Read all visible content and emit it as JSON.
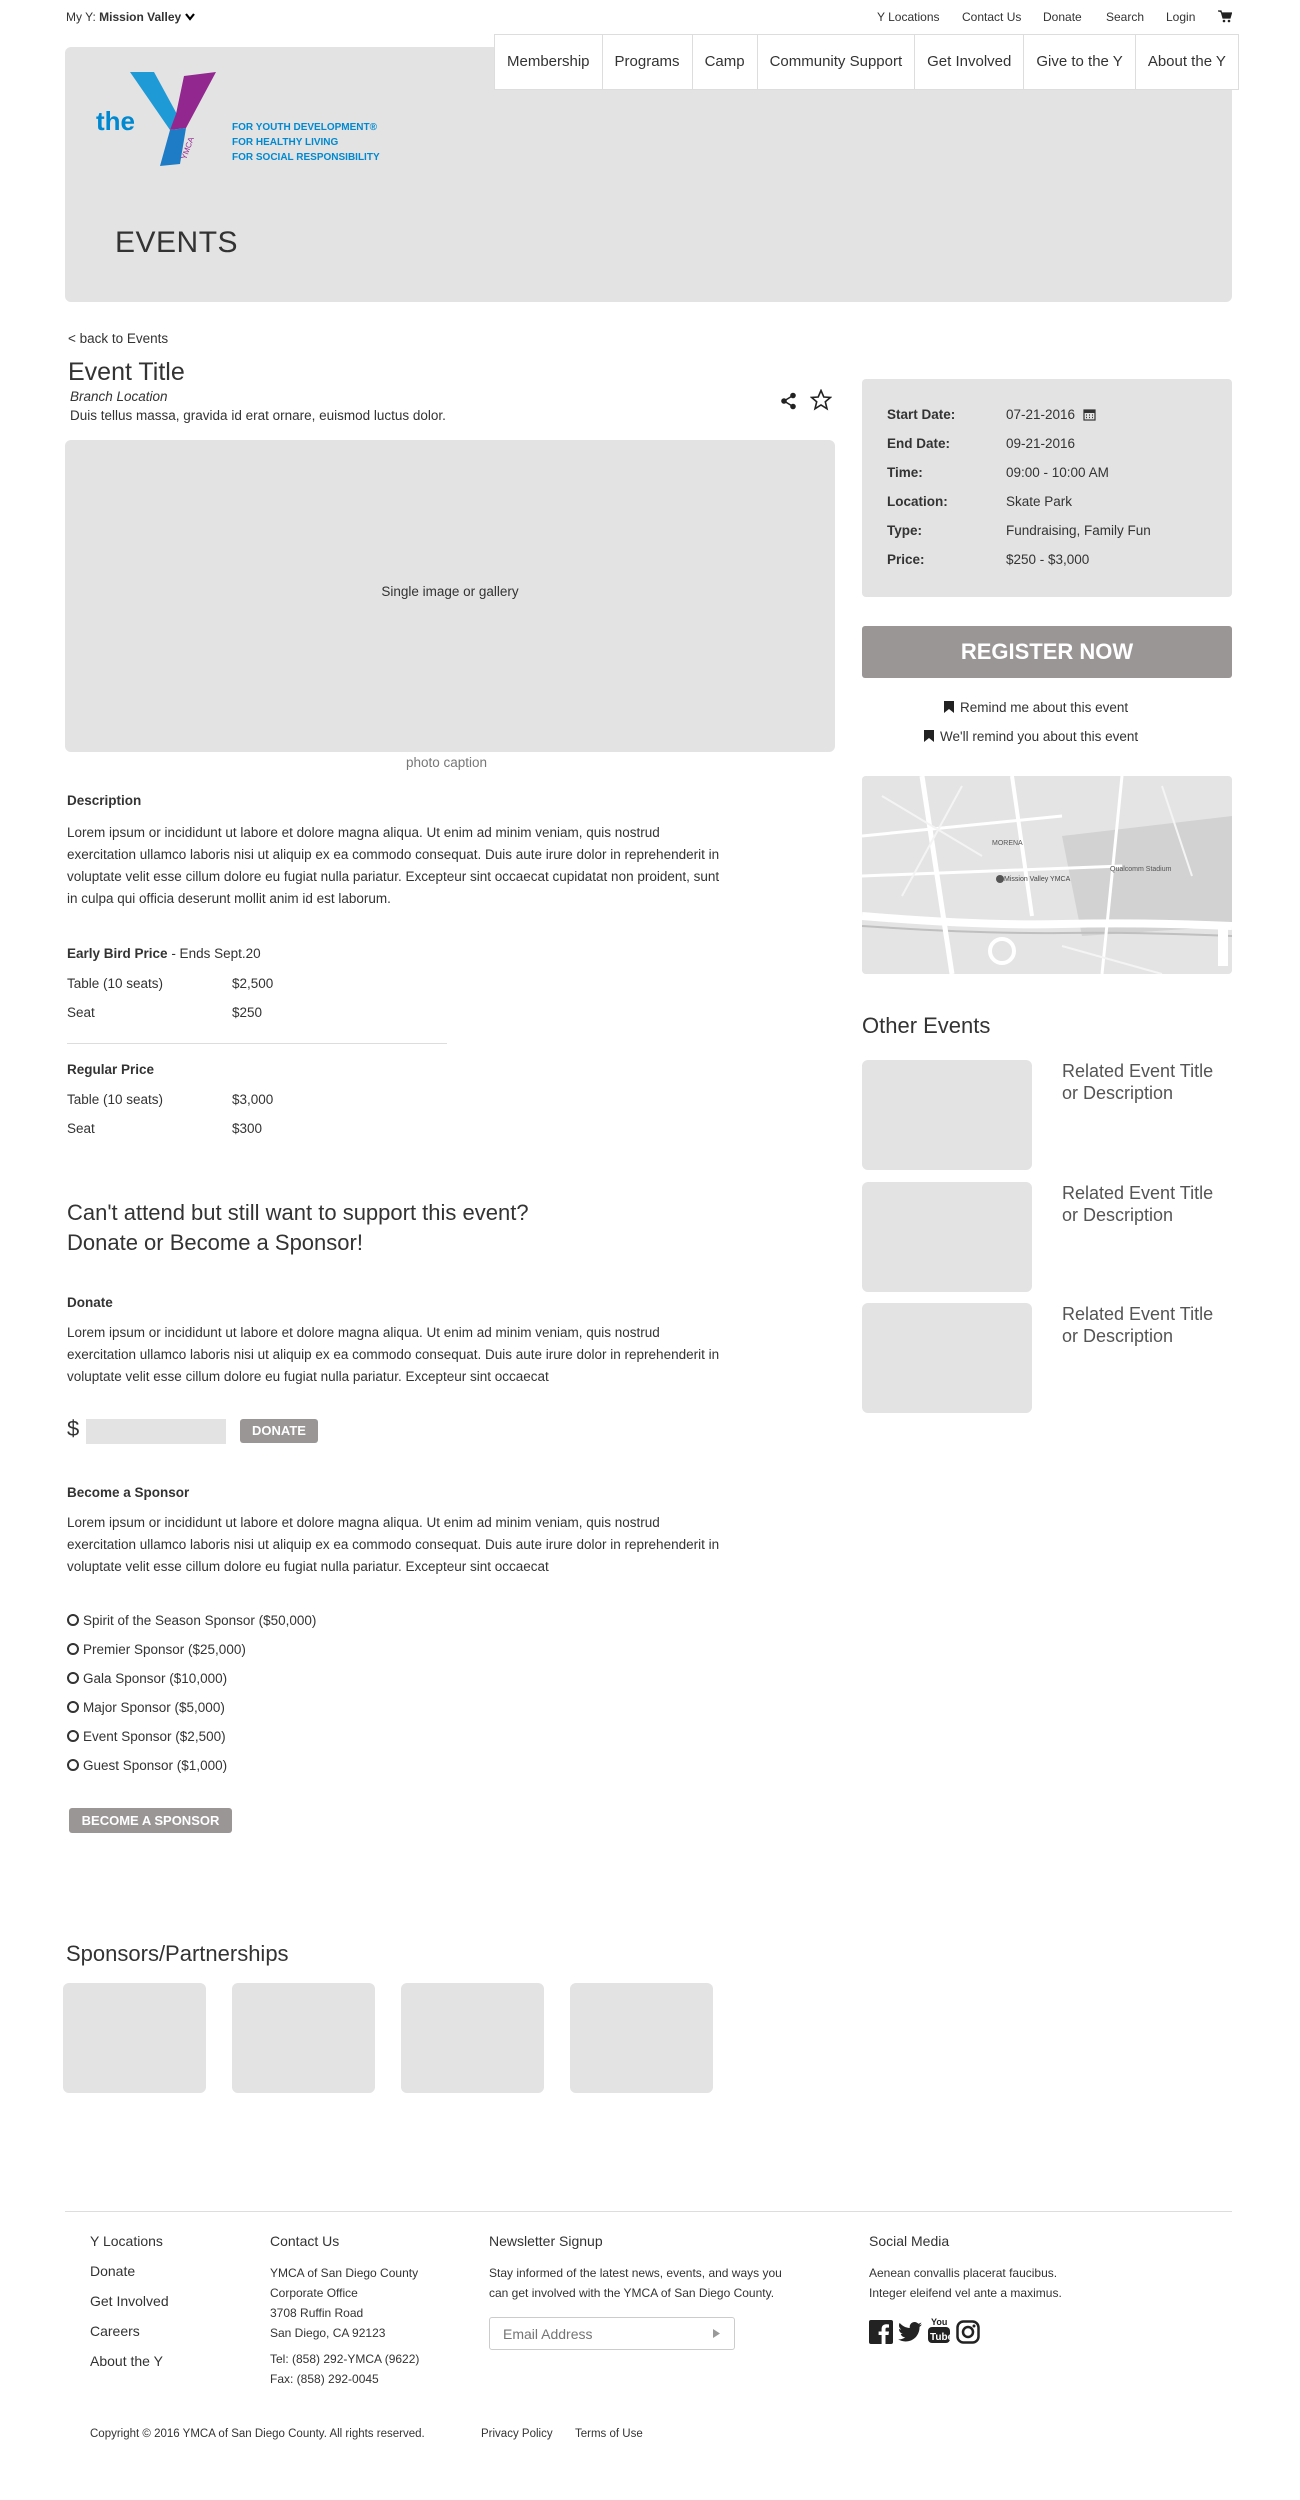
{
  "topbar": {
    "my_y_label": "My Y:",
    "my_y_value": "Mission Valley",
    "links": [
      "Y Locations",
      "Contact Us",
      "Donate",
      "Search",
      "Login"
    ]
  },
  "nav": [
    "Membership",
    "Programs",
    "Camp",
    "Community Support",
    "Get Involved",
    "Give to the Y",
    "About the Y"
  ],
  "logo": {
    "the": "the",
    "ymca": "YMCA",
    "tagline": [
      "FOR YOUTH DEVELOPMENT®",
      "FOR HEALTHY LIVING",
      "FOR SOCIAL RESPONSIBILITY"
    ]
  },
  "hero": {
    "title": "EVENTS"
  },
  "back_link": "< back to Events",
  "event": {
    "title": "Event Title",
    "branch": "Branch Location",
    "summary": "Duis tellus massa, gravida id erat ornare, euismod luctus dolor.",
    "gallery_label": "Single image or gallery",
    "caption": "photo caption"
  },
  "description": {
    "heading": "Description",
    "text": "Lorem ipsum or incididunt ut labore et dolore magna aliqua. Ut enim ad minim veniam, quis nostrud exercitation ullamco laboris nisi ut aliquip ex ea commodo consequat. Duis aute irure dolor in reprehenderit in voluptate velit esse cillum dolore eu fugiat nulla pariatur. Excepteur sint occaecat cupidatat non proident, sunt in culpa qui officia deserunt mollit anim id est laborum."
  },
  "early_bird": {
    "heading": "Early Bird Price",
    "suffix": " - Ends Sept.20",
    "rows": [
      {
        "item": "Table (10 seats)",
        "price": "$2,500"
      },
      {
        "item": "Seat",
        "price": "$250"
      }
    ]
  },
  "regular": {
    "heading": "Regular Price",
    "rows": [
      {
        "item": "Table (10 seats)",
        "price": "$3,000"
      },
      {
        "item": "Seat",
        "price": "$300"
      }
    ]
  },
  "support": {
    "line1": "Can't attend but still want to support this event?",
    "line2": "Donate or Become a Sponsor!"
  },
  "donate": {
    "heading": "Donate",
    "text": "Lorem ipsum or incididunt ut labore et dolore magna aliqua. Ut enim ad minim veniam, quis nostrud exercitation ullamco laboris nisi ut aliquip ex ea commodo consequat. Duis aute irure dolor in reprehenderit in voluptate velit esse cillum dolore eu fugiat nulla pariatur. Excepteur sint occaecat",
    "currency": "$",
    "amount": "",
    "button": "DONATE"
  },
  "sponsor": {
    "heading": "Become a Sponsor",
    "text": "Lorem ipsum or incididunt ut labore et dolore magna aliqua. Ut enim ad minim veniam, quis nostrud exercitation ullamco laboris nisi ut aliquip ex ea commodo consequat. Duis aute irure dolor in reprehenderit in voluptate velit esse cillum dolore eu fugiat nulla pariatur. Excepteur sint occaecat",
    "options": [
      "Spirit of the Season Sponsor ($50,000)",
      "Premier Sponsor ($25,000)",
      "Gala Sponsor ($10,000)",
      "Major Sponsor ($5,000)",
      "Event Sponsor ($2,500)",
      "Guest Sponsor ($1,000)"
    ],
    "button": "BECOME A SPONSOR"
  },
  "details": {
    "start_label": "Start Date:",
    "start": "07-21-2016",
    "end_label": "End Date:",
    "end": "09-21-2016",
    "time_label": "Time:",
    "time": "09:00 - 10:00 AM",
    "location_label": "Location:",
    "location": "Skate Park",
    "type_label": "Type:",
    "type": "Fundraising, Family Fun",
    "price_label": "Price:",
    "price": "$250 - $3,000"
  },
  "register": {
    "button": "REGISTER NOW",
    "remind_link": "Remind me about this event",
    "remind_confirm": "We'll remind you about this event"
  },
  "map": {
    "labels": [
      "Mission Valley YMCA",
      "MORENA",
      "Qualcomm Stadium"
    ]
  },
  "other_events": {
    "heading": "Other Events",
    "items": [
      {
        "line1": "Related Event Title",
        "line2": "or Description"
      },
      {
        "line1": "Related Event Title",
        "line2": "or Description"
      },
      {
        "line1": "Related Event Title",
        "line2": "or Description"
      }
    ]
  },
  "sponsors": {
    "heading": "Sponsors/Partnerships"
  },
  "footer": {
    "links": [
      "Y Locations",
      "Donate",
      "Get Involved",
      "Careers",
      "About the Y"
    ],
    "contact_heading": "Contact Us",
    "contact_lines": [
      "YMCA of San Diego County",
      "Corporate Office",
      "3708 Ruffin Road",
      "San Diego, CA 92123"
    ],
    "tel": "Tel: (858) 292-YMCA (9622)",
    "fax": "Fax: (858) 292-0045",
    "newsletter_heading": "Newsletter Signup",
    "newsletter_text_1": "Stay informed of the latest news, events, and ways you",
    "newsletter_text_2": "can get involved with the YMCA of San Diego County.",
    "email_placeholder": "Email Address",
    "social_heading": "Social Media",
    "social_text_1": "Aenean convallis placerat faucibus.",
    "social_text_2": "Integer eleifend vel ante a maximus.",
    "copyright": "Copyright © 2016 YMCA of San Diego County. All rights reserved.",
    "privacy": "Privacy Policy",
    "terms": "Terms of Use"
  }
}
